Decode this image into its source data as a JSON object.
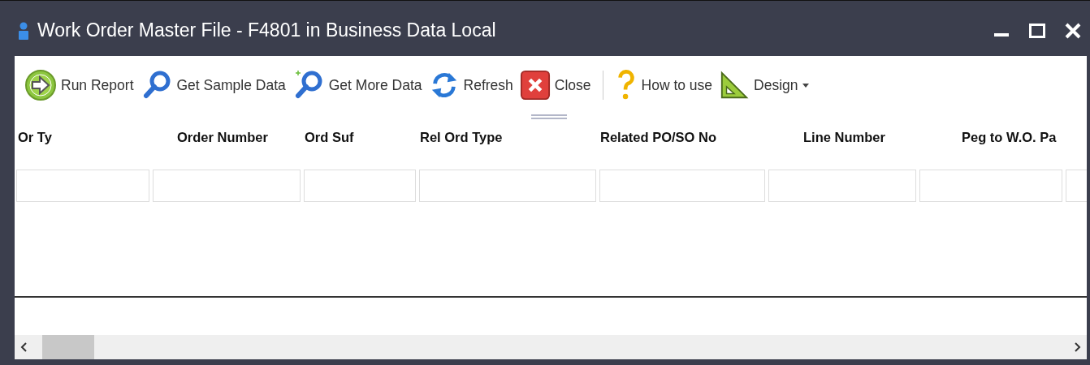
{
  "window": {
    "title": "Work Order Master File - F4801 in Business Data Local"
  },
  "toolbar": [
    {
      "label": "Run Report",
      "kind": "run"
    },
    {
      "label": "Get Sample Data",
      "kind": "sample"
    },
    {
      "label": "Get More Data",
      "kind": "more"
    },
    {
      "label": "Refresh",
      "kind": "refresh"
    },
    {
      "label": "Close",
      "kind": "close"
    },
    {
      "kind": "separator"
    },
    {
      "label": "How to use",
      "kind": "help"
    },
    {
      "label": "Design",
      "kind": "design"
    }
  ],
  "table": {
    "columns": [
      {
        "header": "Or Ty"
      },
      {
        "header": "Order Number"
      },
      {
        "header": "Ord Suf"
      },
      {
        "header": "Rel Ord Type"
      },
      {
        "header": "Related PO/SO No"
      },
      {
        "header": "Line Number"
      },
      {
        "header": "Peg to W.O. Pa"
      }
    ]
  }
}
